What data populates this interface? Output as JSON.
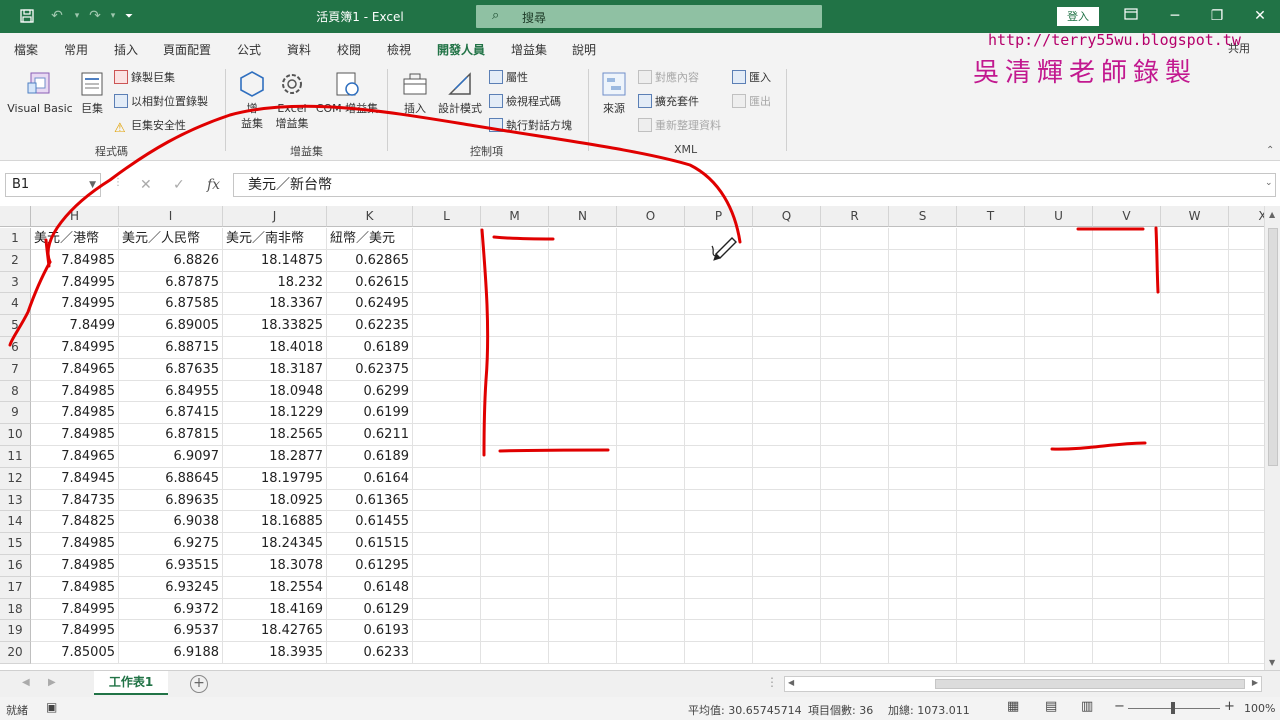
{
  "app": {
    "doc_title": "活頁簿1 - Excel",
    "search_placeholder": "搜尋",
    "signin_label": "登入"
  },
  "ribbon": {
    "tabs": [
      "檔案",
      "常用",
      "插入",
      "頁面配置",
      "公式",
      "資料",
      "校閱",
      "檢視",
      "開發人員",
      "增益集",
      "說明"
    ],
    "active_tab": "開發人員",
    "code_group": {
      "visual_basic": "Visual Basic",
      "macros": "巨集",
      "record_macro": "錄製巨集",
      "relative_ref": "以相對位置錄製",
      "macro_security": "巨集安全性",
      "label": "程式碼"
    },
    "addins_group": {
      "addins_line1": "增",
      "addins_line2": "益集",
      "excel_addins_line1": "Excel",
      "excel_addins_line2": "增益集",
      "com_addins": "COM 增益集",
      "label": "增益集"
    },
    "controls_group": {
      "insert": "插入",
      "design_mode": "設計模式",
      "properties": "屬性",
      "view_code": "檢視程式碼",
      "run_dialog": "執行對話方塊",
      "label": "控制項"
    },
    "xml_group": {
      "source": "來源",
      "map_props": "對應內容",
      "expansion_packs": "擴充套件",
      "refresh_data": "重新整理資料",
      "import": "匯入",
      "export": "匯出",
      "label": "XML"
    },
    "share_label": "共用"
  },
  "watermark": {
    "url": "http://terry55wu.blogspot.tw",
    "name": "吳清輝老師錄製"
  },
  "formula_bar": {
    "name_box": "B1",
    "formula": "美元／新台幣"
  },
  "grid": {
    "columns": [
      "H",
      "I",
      "J",
      "K",
      "L",
      "M",
      "N",
      "O",
      "P",
      "Q",
      "R",
      "S",
      "T",
      "U",
      "V",
      "W",
      "X"
    ],
    "row_numbers": [
      "1",
      "2",
      "3",
      "4",
      "5",
      "6",
      "7",
      "8",
      "9",
      "10",
      "11",
      "12",
      "13",
      "14",
      "15",
      "16",
      "17",
      "18",
      "19",
      "20"
    ],
    "headers": [
      "美元／港幣",
      "美元／人民幣",
      "美元／南非幣",
      "紐幣／美元"
    ],
    "rows": [
      [
        "7.84985",
        "6.8826",
        "18.14875",
        "0.62865"
      ],
      [
        "7.84995",
        "6.87875",
        "18.232",
        "0.62615"
      ],
      [
        "7.84995",
        "6.87585",
        "18.3367",
        "0.62495"
      ],
      [
        "7.8499",
        "6.89005",
        "18.33825",
        "0.62235"
      ],
      [
        "7.84995",
        "6.88715",
        "18.4018",
        "0.6189"
      ],
      [
        "7.84965",
        "6.87635",
        "18.3187",
        "0.62375"
      ],
      [
        "7.84985",
        "6.84955",
        "18.0948",
        "0.6299"
      ],
      [
        "7.84985",
        "6.87415",
        "18.1229",
        "0.6199"
      ],
      [
        "7.84985",
        "6.87815",
        "18.2565",
        "0.6211"
      ],
      [
        "7.84965",
        "6.9097",
        "18.2877",
        "0.6189"
      ],
      [
        "7.84945",
        "6.88645",
        "18.19795",
        "0.6164"
      ],
      [
        "7.84735",
        "6.89635",
        "18.0925",
        "0.61365"
      ],
      [
        "7.84825",
        "6.9038",
        "18.16885",
        "0.61455"
      ],
      [
        "7.84985",
        "6.9275",
        "18.24345",
        "0.61515"
      ],
      [
        "7.84985",
        "6.93515",
        "18.3078",
        "0.61295"
      ],
      [
        "7.84985",
        "6.93245",
        "18.2554",
        "0.6148"
      ],
      [
        "7.84995",
        "6.9372",
        "18.4169",
        "0.6129"
      ],
      [
        "7.84995",
        "6.9537",
        "18.42765",
        "0.6193"
      ],
      [
        "7.85005",
        "6.9188",
        "18.3935",
        "0.6233"
      ]
    ]
  },
  "sheets": {
    "active": "工作表1"
  },
  "status": {
    "ready": "就緒",
    "average": "平均值: 30.65745714",
    "count": "項目個數: 36",
    "sum": "加總: 1073.011",
    "zoom": "100%"
  },
  "colors": {
    "excel_green": "#217346",
    "annotation_red": "#e00000",
    "watermark_magenta": "#c2188f"
  }
}
